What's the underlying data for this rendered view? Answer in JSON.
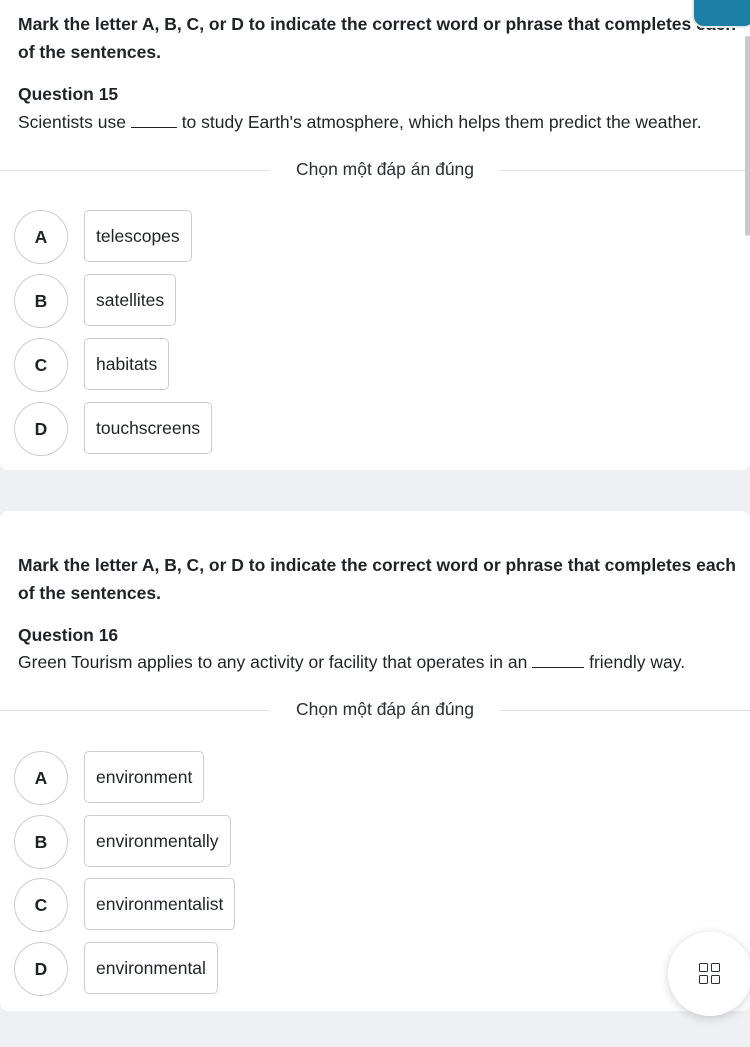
{
  "questions": [
    {
      "instruction": "Mark the letter A, B, C, or D to indicate the correct word or phrase that completes each of the sentences.",
      "title": "Question 15",
      "text_before": "Scientists use ",
      "text_after": " to study Earth's atmosphere, which helps them predict the weather.",
      "choose_label": "Chọn một đáp án đúng",
      "options": [
        {
          "letter": "A",
          "text": "telescopes"
        },
        {
          "letter": "B",
          "text": "satellites"
        },
        {
          "letter": "C",
          "text": "habitats"
        },
        {
          "letter": "D",
          "text": "touchscreens"
        }
      ]
    },
    {
      "instruction": "Mark the letter A, B, C, or D to indicate the correct word or phrase that completes each of the sentences.",
      "title": "Question 16",
      "text_before": "Green Tourism applies to any activity or facility that operates in an ",
      "text_after": " friendly way.",
      "choose_label": "Chọn một đáp án đúng",
      "options": [
        {
          "letter": "A",
          "text": "environment"
        },
        {
          "letter": "B",
          "text": "environmentally"
        },
        {
          "letter": "C",
          "text": "environmentalist"
        },
        {
          "letter": "D",
          "text": "environmental"
        }
      ]
    }
  ],
  "icons": {
    "fab": "grid-menu-icon"
  },
  "colors": {
    "page_background": "#eef0f3",
    "card_background": "#ffffff",
    "border": "#c9ced4",
    "badge_accent": "#1b7fa6"
  }
}
